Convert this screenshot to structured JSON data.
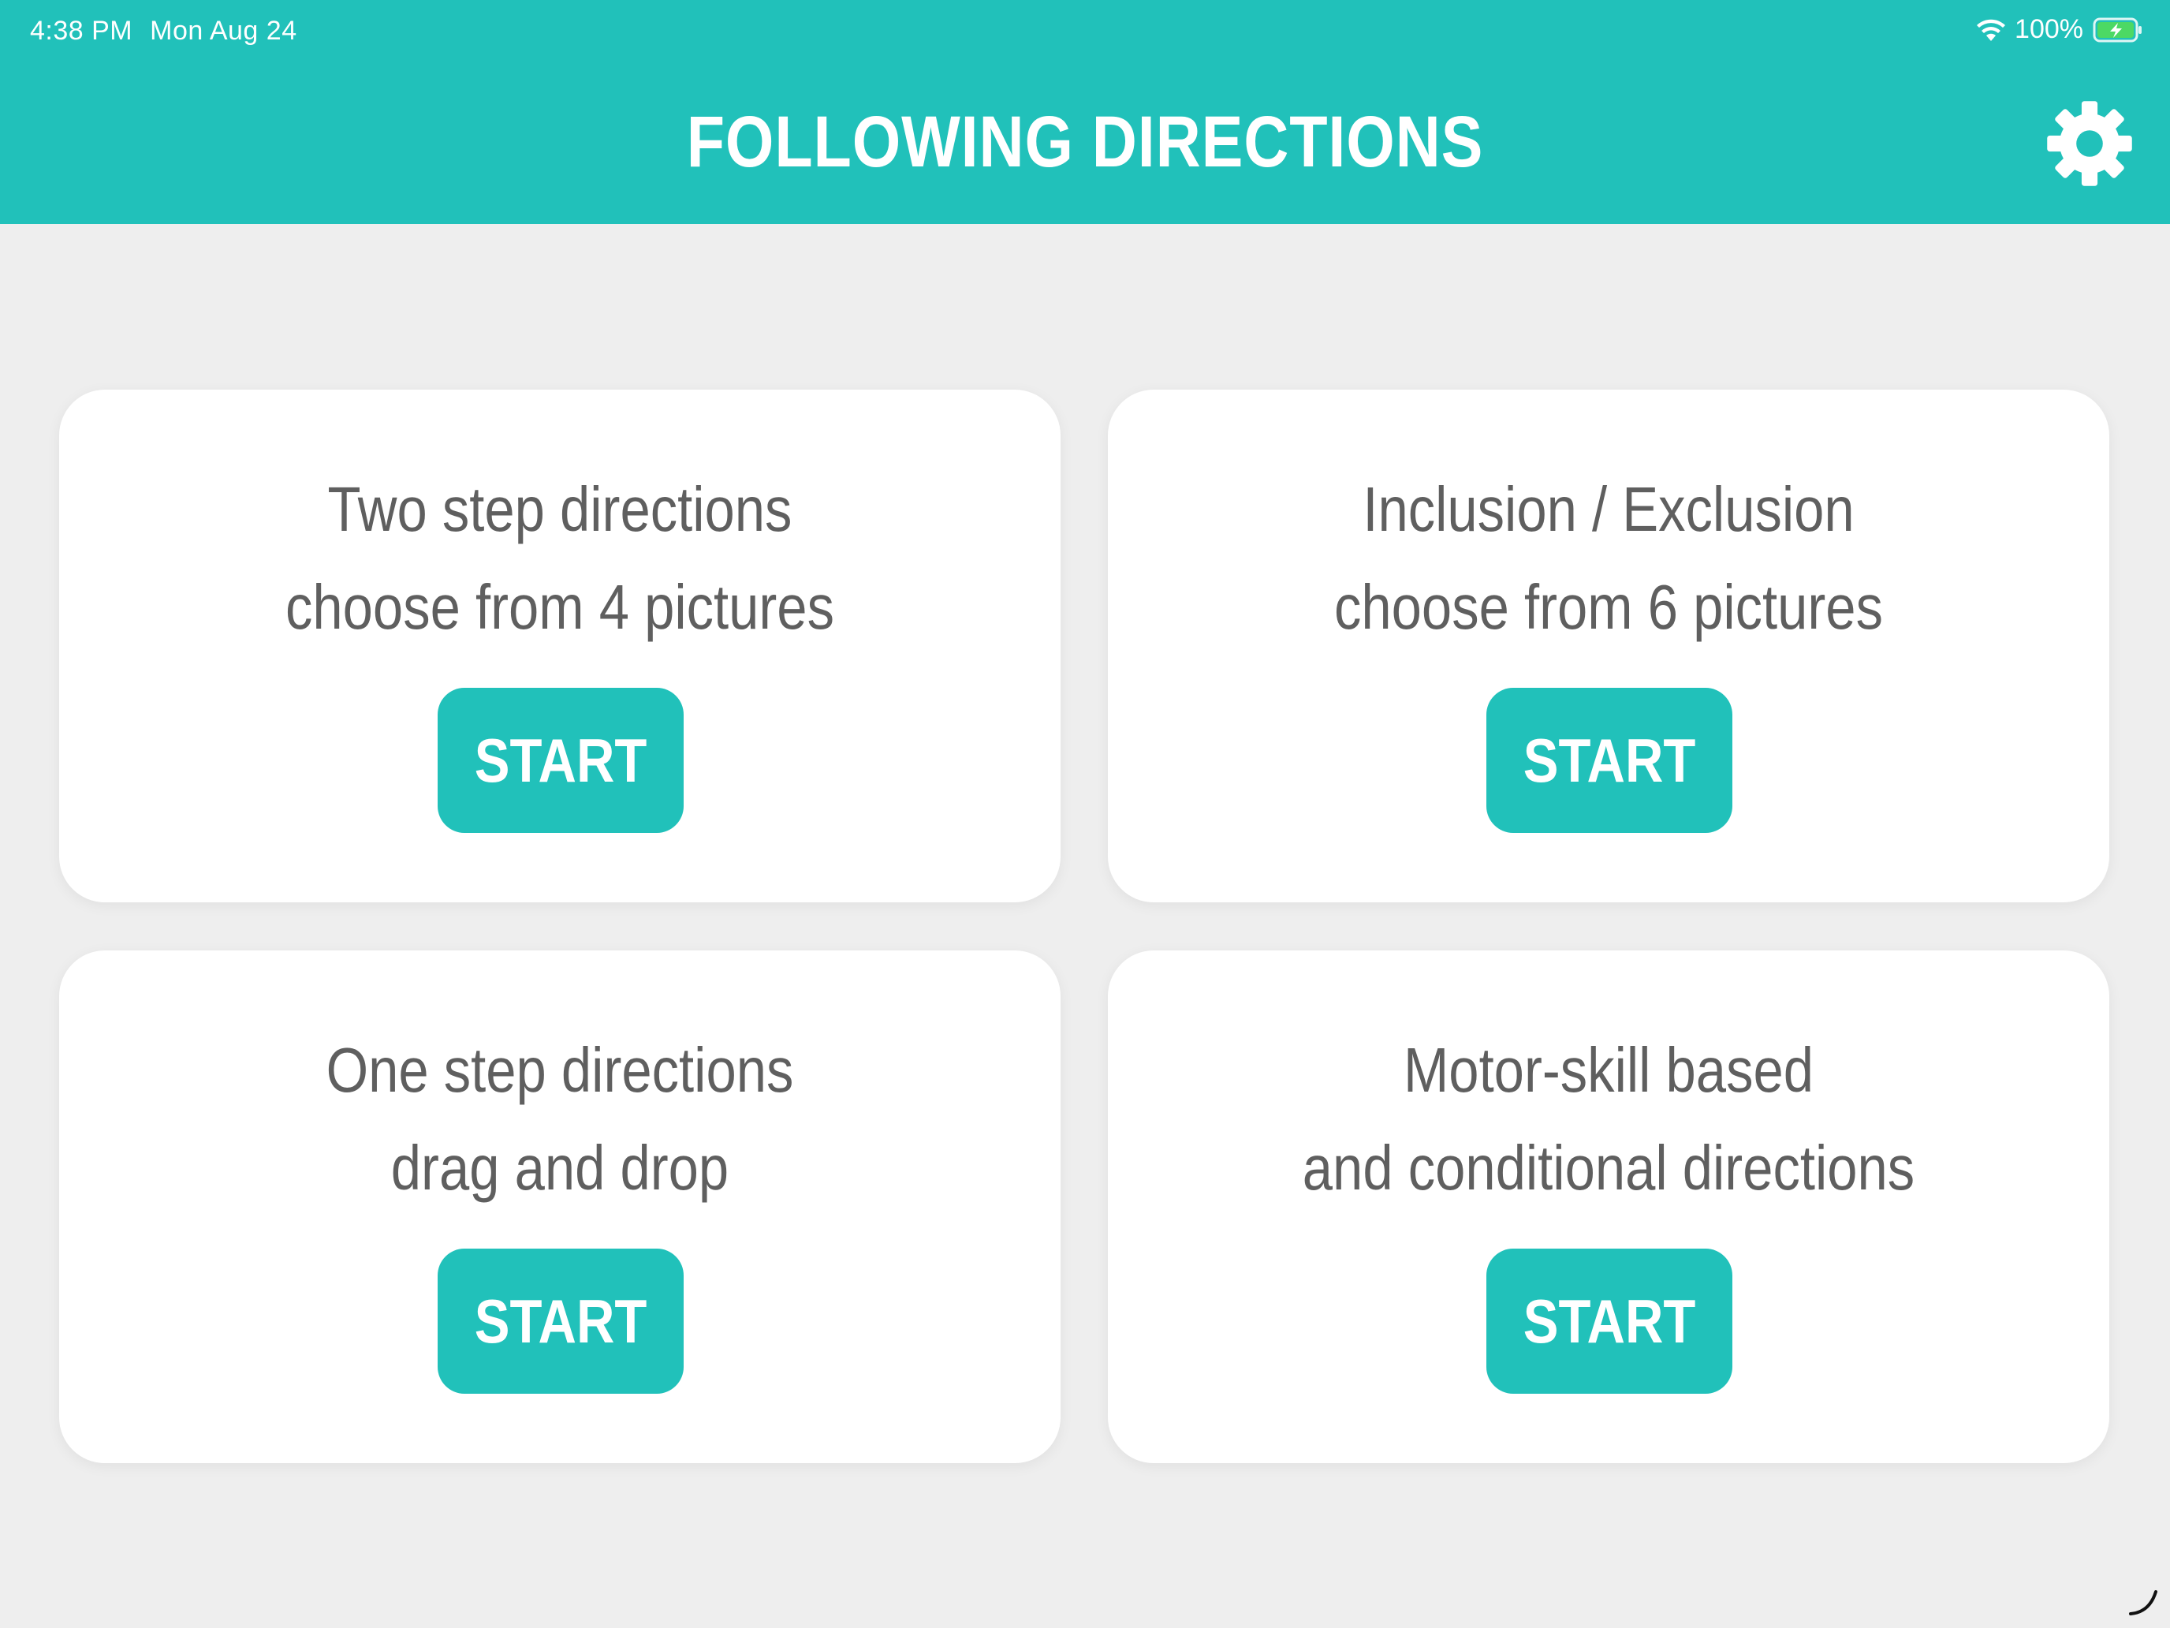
{
  "status_bar": {
    "time": "4:38 PM",
    "date": "Mon Aug 24",
    "battery_percent": "100%"
  },
  "header": {
    "title": "FOLLOWING DIRECTIONS",
    "settings_icon": "gear-icon"
  },
  "colors": {
    "accent": "#21c1ba",
    "background": "#eeeeee",
    "card": "#ffffff",
    "text": "#5f5f5f"
  },
  "cards": [
    {
      "line1": "Two step directions",
      "line2": "choose from 4 pictures",
      "button": "START"
    },
    {
      "line1": "Inclusion / Exclusion",
      "line2": "choose from 6 pictures",
      "button": "START"
    },
    {
      "line1": "One step directions",
      "line2": "drag and drop",
      "button": "START"
    },
    {
      "line1": "Motor-skill based",
      "line2": "and conditional directions",
      "button": "START"
    }
  ]
}
